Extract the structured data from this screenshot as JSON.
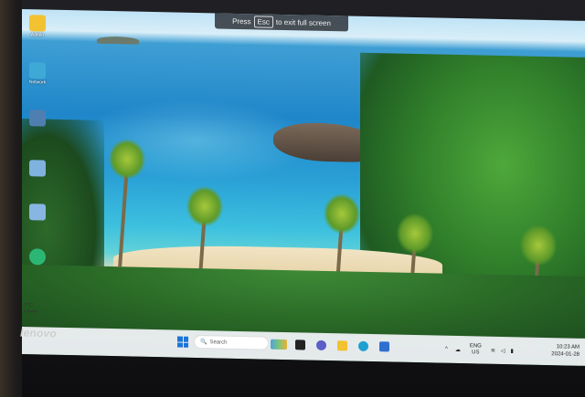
{
  "fullscreen_banner": {
    "prefix": "Press",
    "key": "Esc",
    "suffix": "to exit full screen"
  },
  "desktop_icons": [
    {
      "name": "admin",
      "label": "Admin",
      "color": "#f2c230"
    },
    {
      "name": "network",
      "label": "Network",
      "color": "#3fa9d6"
    },
    {
      "name": "control-panel",
      "label": "",
      "color": "#4e7fb0"
    },
    {
      "name": "app-1",
      "label": "",
      "color": "#7fb2df"
    },
    {
      "name": "app-2",
      "label": "",
      "color": "#88b6e2"
    },
    {
      "name": "edge",
      "label": "",
      "color": "#2bb673"
    }
  ],
  "weather": {
    "temp": "7°C",
    "condition": "Cloudy"
  },
  "taskbar": {
    "search_placeholder": "Search",
    "pinned_icons": [
      "start-icon",
      "widgets-icon",
      "task-view-icon",
      "chat-icon",
      "file-explorer-icon",
      "edge-icon",
      "store-icon"
    ]
  },
  "tray": {
    "language": "ENG",
    "region": "US",
    "time": "10:23 AM",
    "date": "2024-01-28"
  },
  "laptop_brand": "lenovo",
  "colors": {
    "start_blue": "#1c74d8",
    "taskbar_bg": "#eceef2"
  }
}
